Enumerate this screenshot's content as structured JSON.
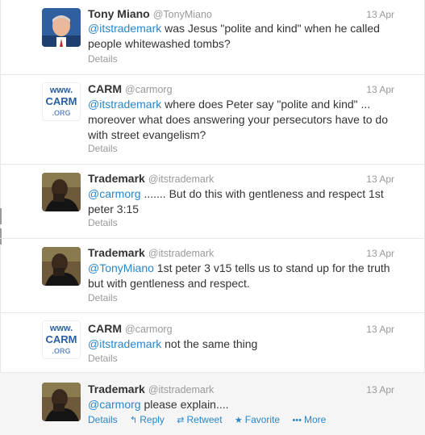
{
  "tweets": [
    {
      "fullname": "Tony Miano",
      "username": "@TonyMiano",
      "time": "13 Apr",
      "mention": "@itstrademark",
      "text_after": " was Jesus \"polite and kind\" when he called people whitewashed tombs?",
      "details": "Details"
    },
    {
      "fullname": "CARM",
      "username": "@carmorg",
      "time": "13 Apr",
      "mention": "@itstrademark",
      "text_after": " where does Peter say \"polite and kind\" ... moreover what does answering your persecutors have to do with street evangelism?",
      "details": "Details",
      "avatar_lines": [
        "www.",
        "CARM",
        ".ORG"
      ]
    },
    {
      "fullname": "Trademark",
      "username": "@itstrademark",
      "time": "13 Apr",
      "mention": "@carmorg",
      "text_after": "  ....... But do this with gentleness and respect 1st peter 3:15",
      "details": "Details"
    },
    {
      "fullname": "Trademark",
      "username": "@itstrademark",
      "time": "13 Apr",
      "mention": "@TonyMiano",
      "text_after": " 1st peter 3 v15 tells us to stand up for the truth but with gentleness and respect.",
      "details": "Details"
    },
    {
      "fullname": "CARM",
      "username": "@carmorg",
      "time": "13 Apr",
      "mention": "@itstrademark",
      "text_after": " not the same thing",
      "details": "Details",
      "avatar_lines": [
        "www.",
        "CARM",
        ".ORG"
      ]
    },
    {
      "fullname": "Trademark",
      "username": "@itstrademark",
      "time": "13 Apr",
      "mention": "@carmorg",
      "text_after": "  please  explain....",
      "details": "Details",
      "reply": "Reply",
      "retweet": "Retweet",
      "favorite": "Favorite",
      "more": "More"
    }
  ],
  "colors": {
    "link": "#2a86c8",
    "meta": "#999999",
    "text": "#333333"
  },
  "icons": {
    "reply": "reply-arrow-icon",
    "retweet": "retweet-icon",
    "favorite": "star-icon",
    "more": "more-dots-icon"
  }
}
